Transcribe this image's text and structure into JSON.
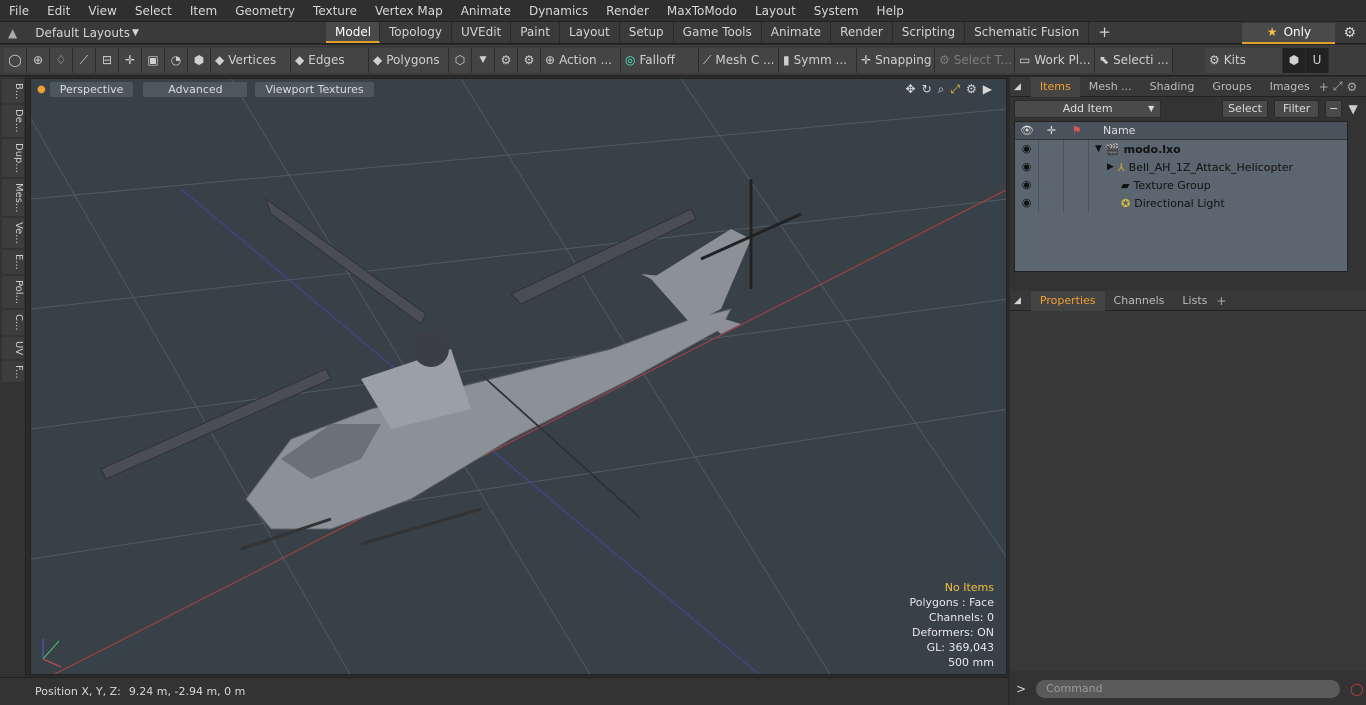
{
  "menu": [
    "File",
    "Edit",
    "View",
    "Select",
    "Item",
    "Geometry",
    "Texture",
    "Vertex Map",
    "Animate",
    "Dynamics",
    "Render",
    "MaxToModo",
    "Layout",
    "System",
    "Help"
  ],
  "layouts": {
    "label": "Default Layouts"
  },
  "tabs": [
    "Model",
    "Topology",
    "UVEdit",
    "Paint",
    "Layout",
    "Setup",
    "Game Tools",
    "Animate",
    "Render",
    "Scripting",
    "Schematic Fusion"
  ],
  "only_label": "Only",
  "toolbar": {
    "vertices": "Vertices",
    "edges": "Edges",
    "polygons": "Polygons",
    "action": "Action ...",
    "falloff": "Falloff",
    "mesh": "Mesh C ...",
    "symm": "Symm ...",
    "snapping": "Snapping",
    "select_t": "Select T...",
    "work_pl": "Work Pl...",
    "selecti": "Selecti ...",
    "kits": "Kits"
  },
  "left_tabs": [
    "B...",
    "De...",
    "Dup...",
    "Mes...",
    "Ve...",
    "E...",
    "Pol...",
    "C...",
    "UV",
    "F..."
  ],
  "viewport": {
    "perspective": "Perspective",
    "advanced": "Advanced",
    "textures": "Viewport Textures"
  },
  "stats": {
    "no_items": "No Items",
    "polygons": "Polygons : Face",
    "channels": "Channels: 0",
    "deformers": "Deformers: ON",
    "gl": "GL: 369,043",
    "scale": "500 mm"
  },
  "status": {
    "position_label": "Position X, Y, Z:",
    "position_value": "9.24 m, -2.94 m, 0 m"
  },
  "panel_tabs": [
    "Items",
    "Mesh ...",
    "Shading",
    "Groups",
    "Images"
  ],
  "items_bar": {
    "add_item": "Add Item",
    "select": "Select",
    "filter": "Filter"
  },
  "tree": {
    "name_header": "Name",
    "rows": [
      {
        "label": "modo.lxo"
      },
      {
        "label": "Bell_AH_1Z_Attack_Helicopter"
      },
      {
        "label": "Texture Group"
      },
      {
        "label": "Directional Light"
      }
    ]
  },
  "props_tabs": [
    "Properties",
    "Channels",
    "Lists"
  ],
  "command": {
    "placeholder": "Command"
  },
  "colors": {
    "accent": "#f0a030",
    "viewport_bg": "#394148"
  }
}
